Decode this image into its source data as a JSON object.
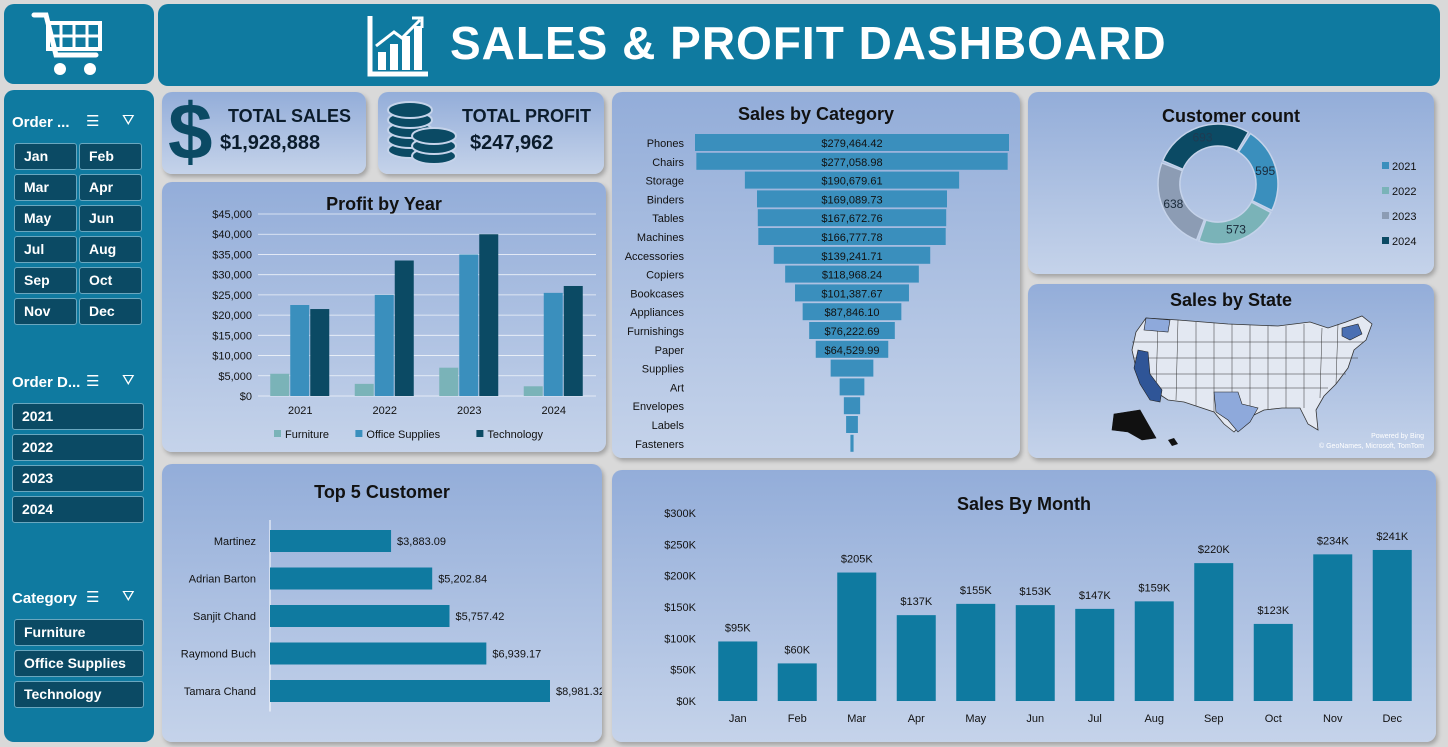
{
  "header": {
    "title": "SALES & PROFIT DASHBOARD"
  },
  "slicers": {
    "order_month": {
      "title": "Order ...",
      "items": [
        "Jan",
        "Feb",
        "Mar",
        "Apr",
        "May",
        "Jun",
        "Jul",
        "Aug",
        "Sep",
        "Oct",
        "Nov",
        "Dec"
      ]
    },
    "order_year": {
      "title": "Order D...",
      "items": [
        "2021",
        "2022",
        "2023",
        "2024"
      ]
    },
    "category": {
      "title": "Category",
      "items": [
        "Furniture",
        "Office Supplies",
        "Technology"
      ]
    }
  },
  "kpis": {
    "sales": {
      "label": "TOTAL SALES",
      "value": "$1,928,888"
    },
    "profit": {
      "label": "TOTAL PROFIT",
      "value": "$247,962"
    }
  },
  "map": {
    "title": "Sales by State",
    "credit1": "Powered by Bing",
    "credit2": "© GeoNames, Microsoft, TomTom"
  },
  "colors": {
    "furniture": "#7ab3b8",
    "office": "#3a8fbd",
    "technology": "#0b4a64",
    "bar": "#0f7aa0",
    "funnel": "#3a8fbd"
  },
  "chart_data": [
    {
      "id": "profit_by_year",
      "type": "bar",
      "title": "Profit by Year",
      "categories": [
        "2021",
        "2022",
        "2023",
        "2024"
      ],
      "series": [
        {
          "name": "Furniture",
          "values": [
            5500,
            3000,
            7000,
            2400
          ]
        },
        {
          "name": "Office Supplies",
          "values": [
            22500,
            25000,
            35000,
            25500
          ]
        },
        {
          "name": "Technology",
          "values": [
            21500,
            33500,
            40000,
            27200
          ]
        }
      ],
      "y_ticks": [
        "$0",
        "$5,000",
        "$10,000",
        "$15,000",
        "$20,000",
        "$25,000",
        "$30,000",
        "$35,000",
        "$40,000",
        "$45,000"
      ],
      "ylim": [
        0,
        45000
      ],
      "legend": "bottom",
      "grid": true
    },
    {
      "id": "sales_by_category",
      "type": "bar",
      "orientation": "horizontal-funnel",
      "title": "Sales by Category",
      "categories": [
        "Phones",
        "Chairs",
        "Storage",
        "Binders",
        "Tables",
        "Machines",
        "Accessories",
        "Copiers",
        "Bookcases",
        "Appliances",
        "Furnishings",
        "Paper",
        "Supplies",
        "Art",
        "Envelopes",
        "Labels",
        "Fasteners"
      ],
      "values": [
        279464.42,
        277058.98,
        190679.61,
        169089.73,
        167672.76,
        166777.78,
        139241.71,
        118968.24,
        101387.67,
        87846.1,
        76222.69,
        64529.99,
        38000,
        22000,
        14500,
        10500,
        2800
      ],
      "labels": [
        "$279,464.42",
        "$277,058.98",
        "$190,679.61",
        "$169,089.73",
        "$167,672.76",
        "$166,777.78",
        "$139,241.71",
        "$118,968.24",
        "$101,387.67",
        "$87,846.10",
        "$76,222.69",
        "$64,529.99",
        "",
        "",
        "",
        "",
        ""
      ]
    },
    {
      "id": "customer_count",
      "type": "pie",
      "style": "donut",
      "title": "Customer count",
      "categories": [
        "2021",
        "2022",
        "2023",
        "2024"
      ],
      "values": [
        595,
        573,
        638,
        693
      ],
      "labels": [
        "595",
        "573",
        "638",
        "693"
      ],
      "legend": "right"
    },
    {
      "id": "top5_customer",
      "type": "bar",
      "orientation": "horizontal",
      "title": "Top 5 Customer",
      "categories": [
        "Martinez",
        "Adrian Barton",
        "Sanjit Chand",
        "Raymond Buch",
        "Tamara Chand"
      ],
      "values": [
        3883.09,
        5202.84,
        5757.42,
        6939.17,
        8981.32
      ],
      "labels": [
        "$3,883.09",
        "$5,202.84",
        "$5,757.42",
        "$6,939.17",
        "$8,981.32"
      ]
    },
    {
      "id": "sales_by_month",
      "type": "bar",
      "title": "Sales By Month",
      "categories": [
        "Jan",
        "Feb",
        "Mar",
        "Apr",
        "May",
        "Jun",
        "Jul",
        "Aug",
        "Sep",
        "Oct",
        "Nov",
        "Dec"
      ],
      "values": [
        95,
        60,
        205,
        137,
        155,
        153,
        147,
        159,
        220,
        123,
        234,
        241
      ],
      "labels": [
        "$95K",
        "$60K",
        "$205K",
        "$137K",
        "$155K",
        "$153K",
        "$147K",
        "$159K",
        "$220K",
        "$123K",
        "$234K",
        "$241K"
      ],
      "y_ticks": [
        "$0K",
        "$50K",
        "$100K",
        "$150K",
        "$200K",
        "$250K",
        "$300K"
      ],
      "ylim": [
        0,
        300
      ]
    }
  ]
}
